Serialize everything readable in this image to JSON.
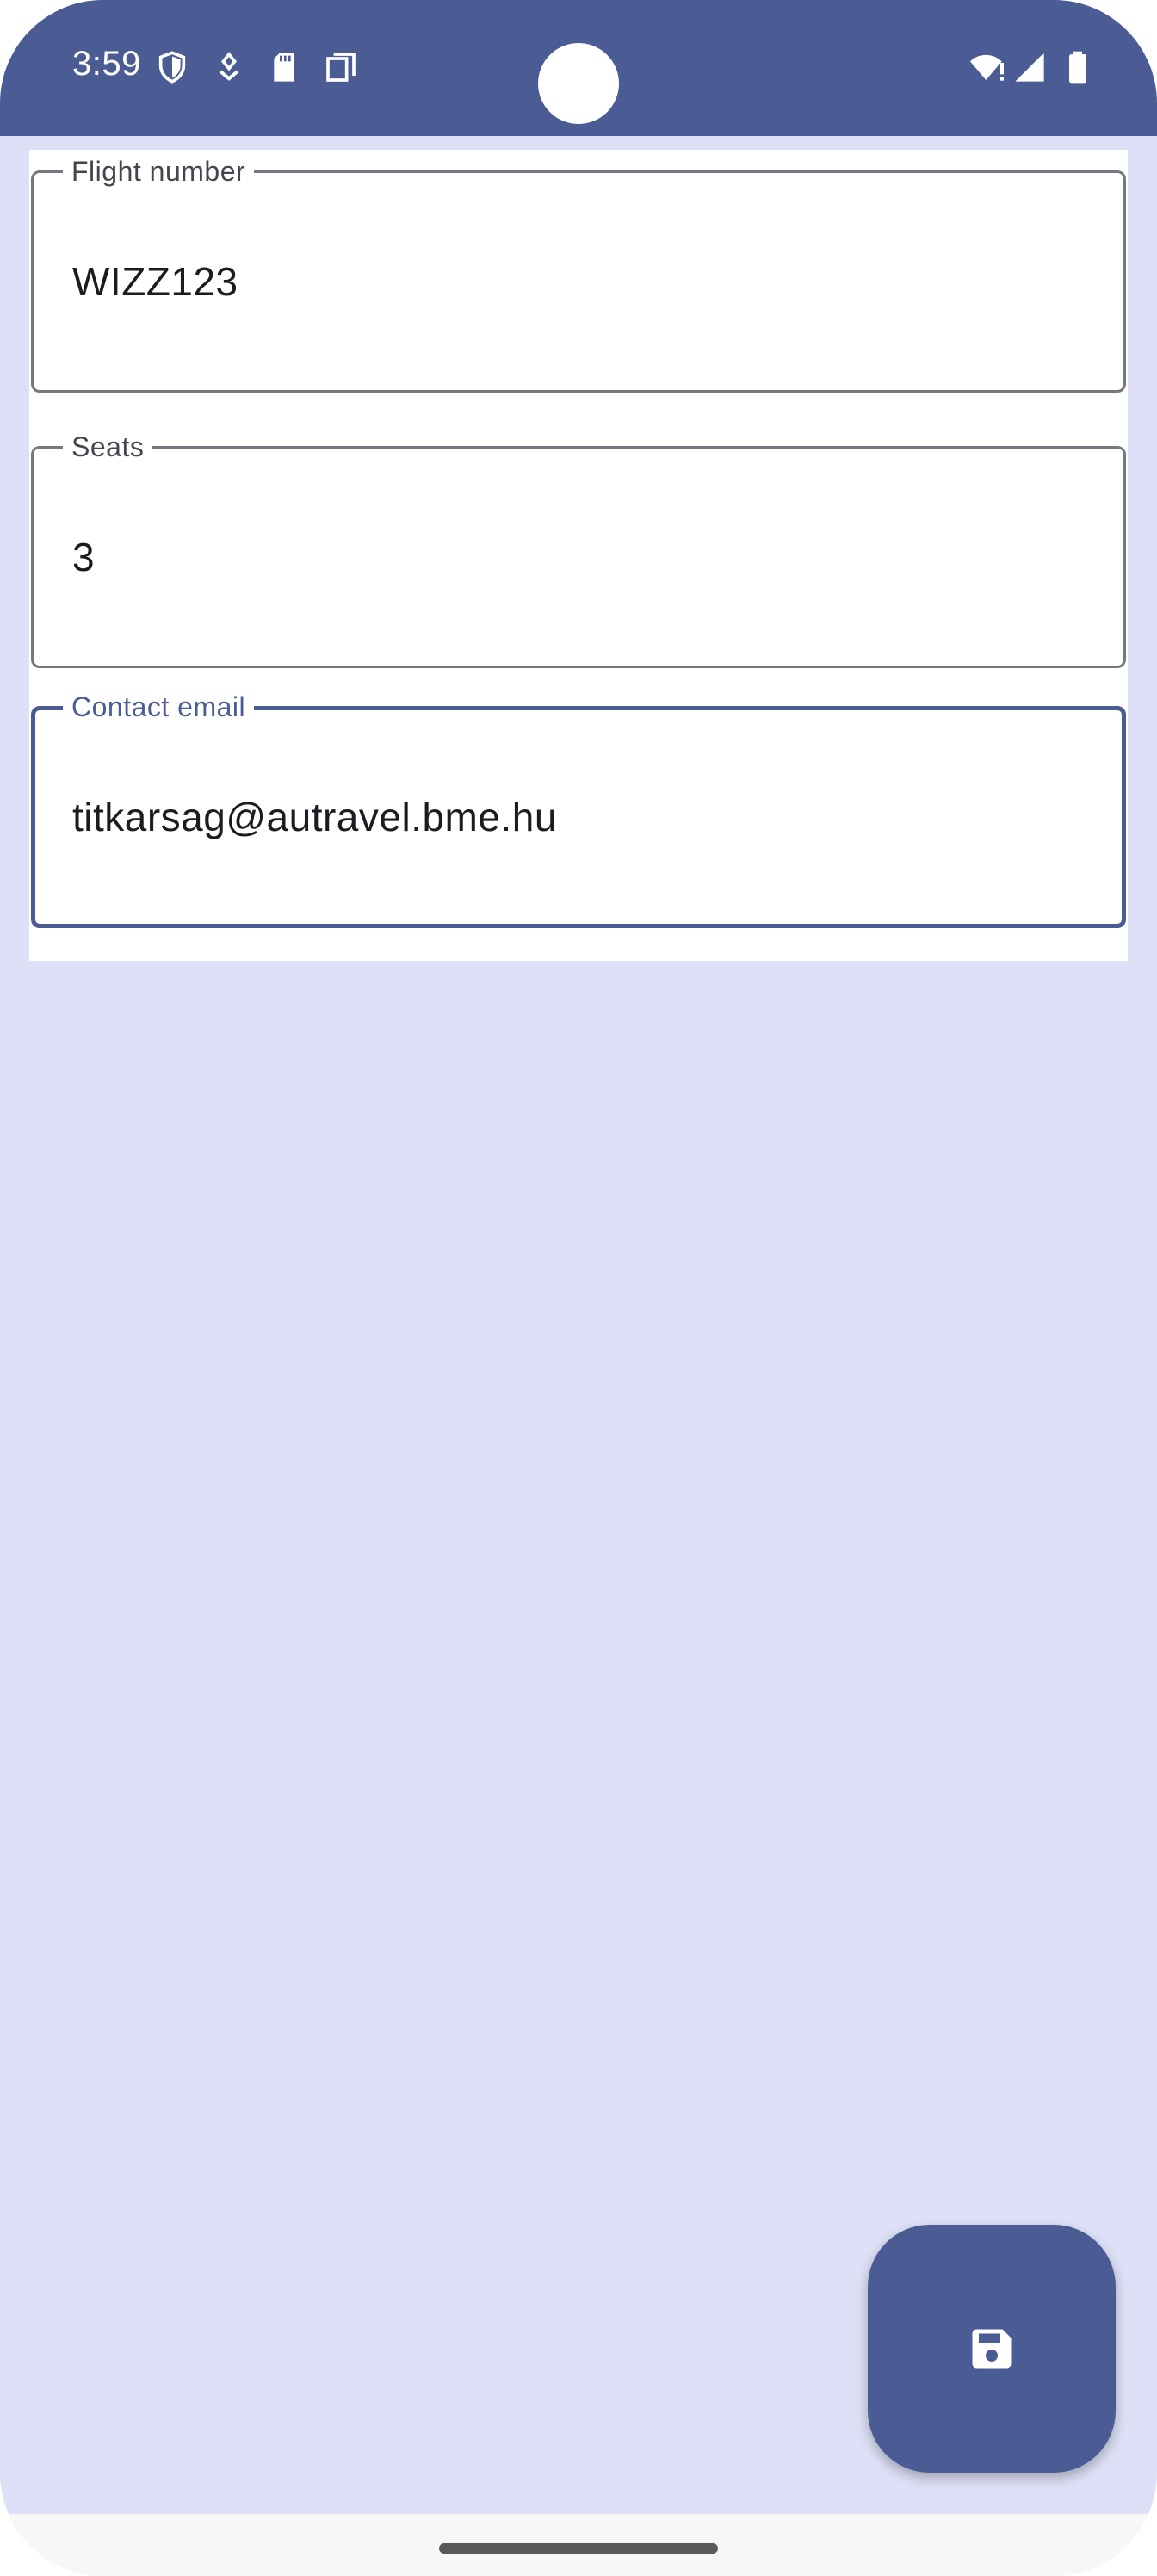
{
  "status_bar": {
    "time": "3:59",
    "left_icons": [
      "shield-icon",
      "location-pin-icon",
      "sd-card-icon",
      "copy-icon"
    ],
    "right_icons": [
      "wifi-alert-icon",
      "cell-signal-icon",
      "battery-icon"
    ],
    "background_color": "#4a5c93"
  },
  "form": {
    "flight_number": {
      "label": "Flight number",
      "value": "WIZZ123"
    },
    "seats": {
      "label": "Seats",
      "value": "3"
    },
    "contact_email": {
      "label": "Contact email",
      "value": "titkarsag@autravel.bme.hu",
      "focused": true
    }
  },
  "fab": {
    "icon": "save-icon",
    "color": "#4a5c93"
  },
  "colors": {
    "background": "#dde0f6",
    "accent": "#4a5c93",
    "outline": "#767780",
    "text": "#1b1b21"
  }
}
